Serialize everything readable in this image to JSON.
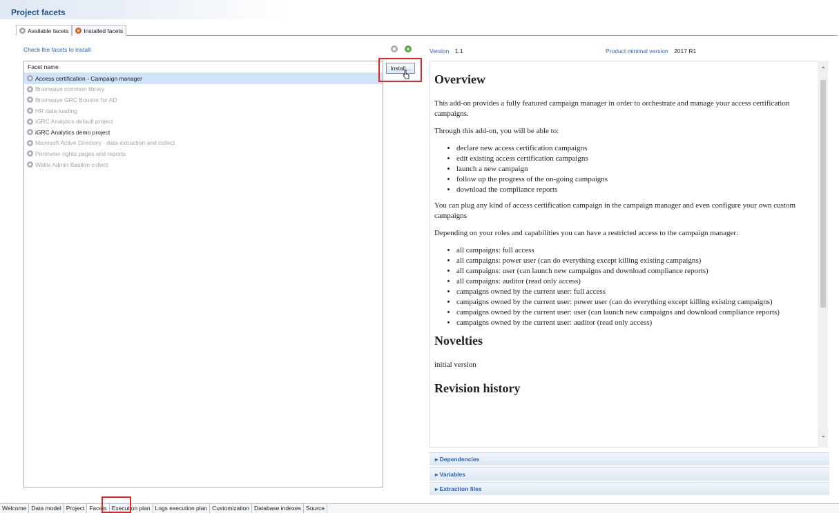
{
  "header": {
    "title": "Project facets"
  },
  "top_tabs": [
    {
      "label": "Available facets",
      "icon": "gear-grey-icon",
      "active": true
    },
    {
      "label": "Installed facets",
      "icon": "gear-orange-icon",
      "active": false
    }
  ],
  "left_panel": {
    "check_label": "Check the facets to install:",
    "column_header": "Facet name",
    "install_button": "Install...",
    "facets": [
      {
        "label": "Access certification - Campaign manager",
        "state": "selected"
      },
      {
        "label": "Brainwave common library",
        "state": "disabled"
      },
      {
        "label": "Brainwave GRC Booster for AD",
        "state": "disabled"
      },
      {
        "label": "HR data loading",
        "state": "disabled"
      },
      {
        "label": "iGRC Analytics default project",
        "state": "disabled"
      },
      {
        "label": "iGRC Analytics demo project",
        "state": "enabled"
      },
      {
        "label": "Microsoft Active Directory - data extraction and collect",
        "state": "disabled"
      },
      {
        "label": "Perimeter rights pages and reports",
        "state": "disabled"
      },
      {
        "label": "Wallix Admin Bastion collect",
        "state": "disabled"
      }
    ]
  },
  "right_panel": {
    "version_label": "Version",
    "version_value": "1.1",
    "product_label": "Product minimal version",
    "product_value": "2017 R1",
    "overview_title": "Overview",
    "overview_p1": "This add-on provides a fully featured campaign manager in order to orchestrate and manage your access certification campaigns.",
    "overview_p2": "Through this add-on, you will be able to:",
    "overview_list": [
      "declare new access certification campaigns",
      "edit existing access certification campaigns",
      "launch a new campaign",
      "follow up the progress of the on-going campaigns",
      "download the compliance reports"
    ],
    "overview_p3": "You can plug any kind of access certification campaign in the campaign manager and even configure your own custom campaigns",
    "overview_p4": "Depending on your roles and capabilities you can have a restricted access to the campaign manager:",
    "roles_list": [
      "all campaigns: full access",
      "all campaigns: power user (can do everything except killing existing campaigns)",
      "all campaigns: user (can launch new campaigns and download compliance reports)",
      "all campaigns: auditor (read only access)",
      "campaigns owned by the current user: full access",
      "campaigns owned by the current user: power user (can do everything except killing existing campaigns)",
      "campaigns owned by the current user: user (can launch new campaigns and download compliance reports)",
      "campaigns owned by the current user: auditor (read only access)"
    ],
    "novelties_title": "Novelties",
    "novelties_text": "initial version",
    "revision_title": "Revision history",
    "sections": [
      "Dependencies",
      "Variables",
      "Extraction files"
    ]
  },
  "bottom_tabs": [
    {
      "label": "Welcome"
    },
    {
      "label": "Data model"
    },
    {
      "label": "Project"
    },
    {
      "label": "Facets",
      "active": true
    },
    {
      "label": "Execution plan"
    },
    {
      "label": "Logs execution plan"
    },
    {
      "label": "Customization"
    },
    {
      "label": "Database indexes"
    },
    {
      "label": "Source"
    }
  ],
  "colors": {
    "accent": "#2a62b8",
    "title": "#1f4f8f",
    "highlight": "#e22626",
    "selection": "#cfe3fa"
  }
}
